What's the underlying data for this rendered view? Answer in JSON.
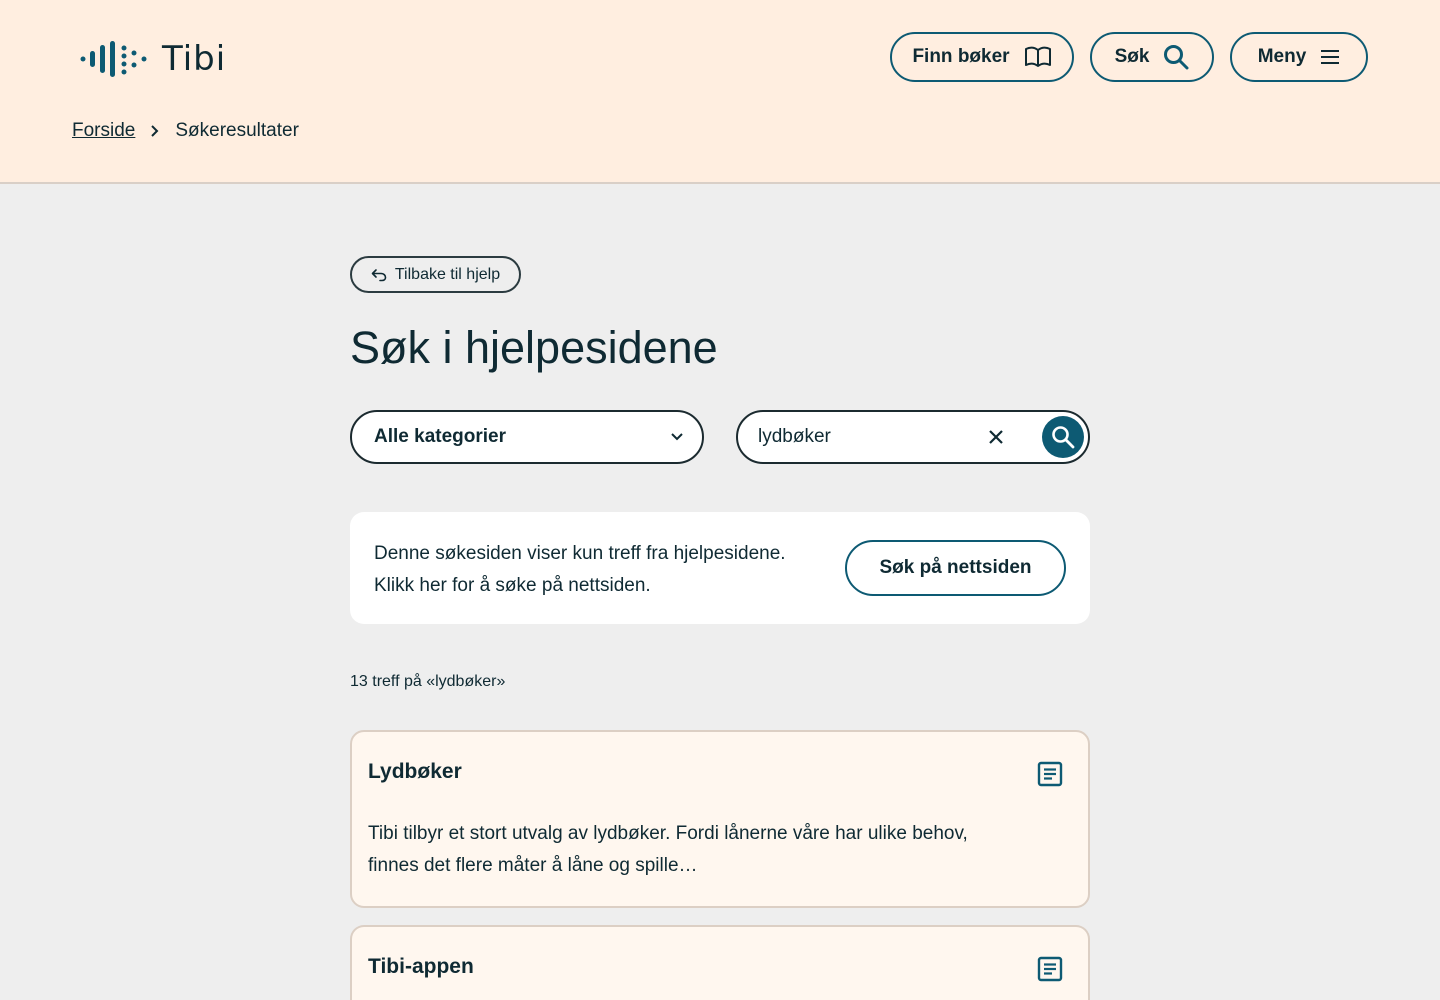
{
  "header": {
    "logo_text": "Tibi",
    "buttons": {
      "find_books": "Finn bøker",
      "search": "Søk",
      "menu": "Meny"
    },
    "breadcrumb": {
      "home": "Forside",
      "current": "Søkeresultater"
    }
  },
  "main": {
    "back_label": "Tilbake til hjelp",
    "title": "Søk i hjelpesidene",
    "category_select": {
      "selected": "Alle kategorier"
    },
    "search": {
      "value": "lydbøker"
    },
    "info": {
      "line1": "Denne søkesiden viser kun treff fra hjelpesidene.",
      "line2": "Klikk her for å søke på nettsiden.",
      "button": "Søk på nettsiden"
    },
    "hits_text": "13 treff på «lydbøker»",
    "results": [
      {
        "title": "Lydbøker",
        "desc_line1": "Tibi tilbyr et stort utvalg av lydbøker. Fordi lånerne våre har ulike behov,",
        "desc_line2": "finnes det flere måter å låne og spille…",
        "icon": "article-icon"
      },
      {
        "title": "Tibi-appen",
        "icon": "article-icon"
      }
    ]
  },
  "colors": {
    "header_bg": "#ffeee0",
    "page_bg": "#eeeeee",
    "accent": "#0d5a73",
    "result_bg": "#fff7ef"
  }
}
